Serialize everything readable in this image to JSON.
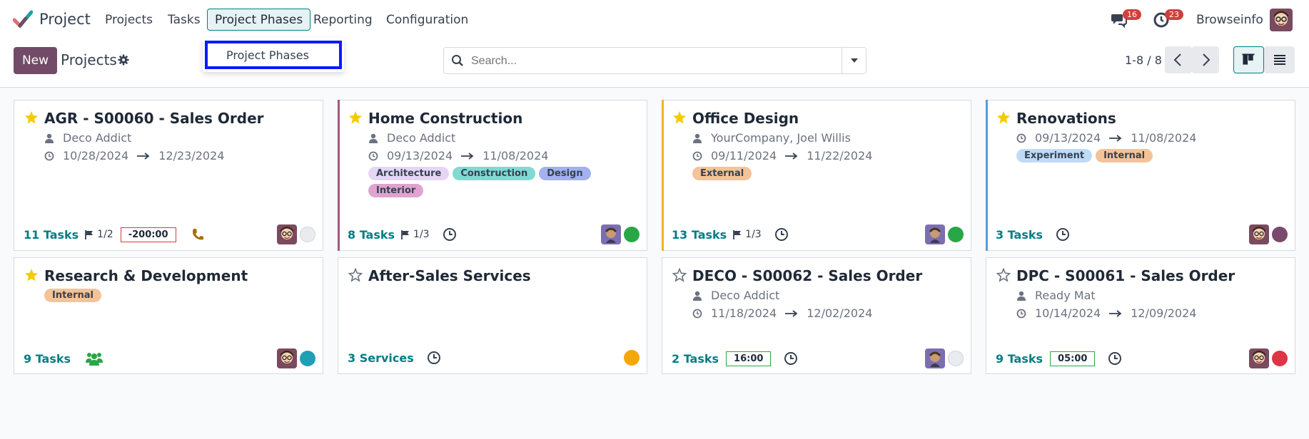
{
  "navbar": {
    "app_name": "Project",
    "menu": [
      "Projects",
      "Tasks",
      "Project Phases",
      "Reporting",
      "Configuration"
    ],
    "messages_count": "16",
    "activities_count": "23",
    "user_name": "Browseinfo"
  },
  "dropdown": {
    "item": "Project Phases"
  },
  "controls": {
    "new_label": "New",
    "breadcrumb": "Projects",
    "search_placeholder": "Search...",
    "pager": "1-8 / 8"
  },
  "colors": {
    "brand": "#714b67",
    "teal": "#017e84",
    "star": "#f3cc00"
  },
  "cards": [
    {
      "title": "AGR - S00060 - Sales Order",
      "customer": "Deco Addict",
      "date_start": "10/28/2024",
      "date_end": "12/23/2024",
      "tasks": "11 Tasks",
      "milestone": "1/2",
      "hours": "-200:00",
      "starred": true
    },
    {
      "title": "Home Construction",
      "customer": "Deco Addict",
      "date_start": "09/13/2024",
      "date_end": "11/08/2024",
      "tags": [
        "Architecture",
        "Construction",
        "Design",
        "Interior"
      ],
      "tasks": "8 Tasks",
      "milestone": "1/3",
      "starred": true
    },
    {
      "title": "Office Design",
      "customer": "YourCompany, Joel Willis",
      "date_start": "09/11/2024",
      "date_end": "11/22/2024",
      "tags": [
        "External"
      ],
      "tasks": "13 Tasks",
      "milestone": "1/3",
      "starred": true
    },
    {
      "title": "Renovations",
      "date_start": "09/13/2024",
      "date_end": "11/08/2024",
      "tags": [
        "Experiment",
        "Internal"
      ],
      "tasks": "3 Tasks",
      "starred": true
    },
    {
      "title": "Research & Development",
      "tags": [
        "Internal"
      ],
      "tasks": "9 Tasks",
      "starred": true
    },
    {
      "title": "After-Sales Services",
      "tasks": "3 Services",
      "starred": false
    },
    {
      "title": "DECO - S00062 - Sales Order",
      "customer": "Deco Addict",
      "date_start": "11/18/2024",
      "date_end": "12/02/2024",
      "tasks": "2 Tasks",
      "hours": "16:00",
      "starred": false
    },
    {
      "title": "DPC - S00061 - Sales Order",
      "customer": "Ready Mat",
      "date_start": "10/14/2024",
      "date_end": "12/09/2024",
      "tasks": "9 Tasks",
      "hours": "05:00",
      "starred": false
    }
  ]
}
